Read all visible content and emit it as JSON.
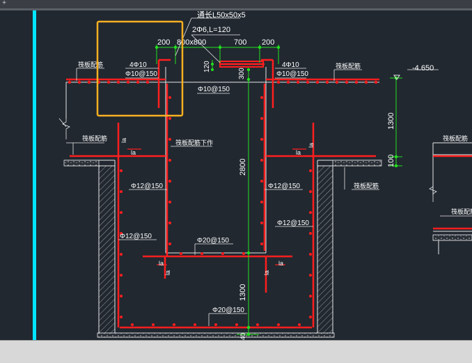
{
  "toolbar": {
    "plus_icon": "plus-icon"
  },
  "drawing": {
    "top_label_1": "通长L50x50x5",
    "top_label_2": "2Φ6,L=120",
    "dims_top": [
      "200",
      "800x800",
      "700",
      "200"
    ],
    "rebar_left_top": "4Φ10",
    "rebar_left_top2": "Φ10@150",
    "rebar_right_top": "4Φ10",
    "rebar_right_top2": "Φ10@150",
    "rebar_mid": "Φ10@150",
    "dim_120": "120",
    "dim_300": "300",
    "dim_2800": "2800",
    "dim_1300_right": "1300",
    "dim_100_right": "100",
    "dim_1300_bottom": "1300",
    "dim_40": "40",
    "elevation": "-4.650",
    "raft_top_left": "筏板配筋",
    "raft_top_right": "筏板配筋",
    "raft_mid_left": "筏板配筋",
    "raft_down": "筏板配筋下作",
    "raft_mid_right": "筏板配筋",
    "raft_far_right_1": "筏板配筋",
    "raft_far_right_2": "筏板配筋",
    "la_labels": [
      "la",
      "la",
      "la",
      "la",
      "la",
      "la",
      "la",
      "la"
    ],
    "rebar_left_wall_1": "Φ12@150",
    "rebar_left_wall_2": "Φ12@150",
    "rebar_right_wall_1": "Φ12@150",
    "rebar_right_wall_2": "Φ12@150",
    "rebar_pit_bottom": "Φ20@150",
    "rebar_base": "Φ20@150"
  },
  "colors": {
    "background": "#212830",
    "rebar": "#ff1e1e",
    "dimension": "#22e11e",
    "text": "#ffffff",
    "axis_cyan": "#00e5ff",
    "highlight_box": "#ffb020"
  }
}
